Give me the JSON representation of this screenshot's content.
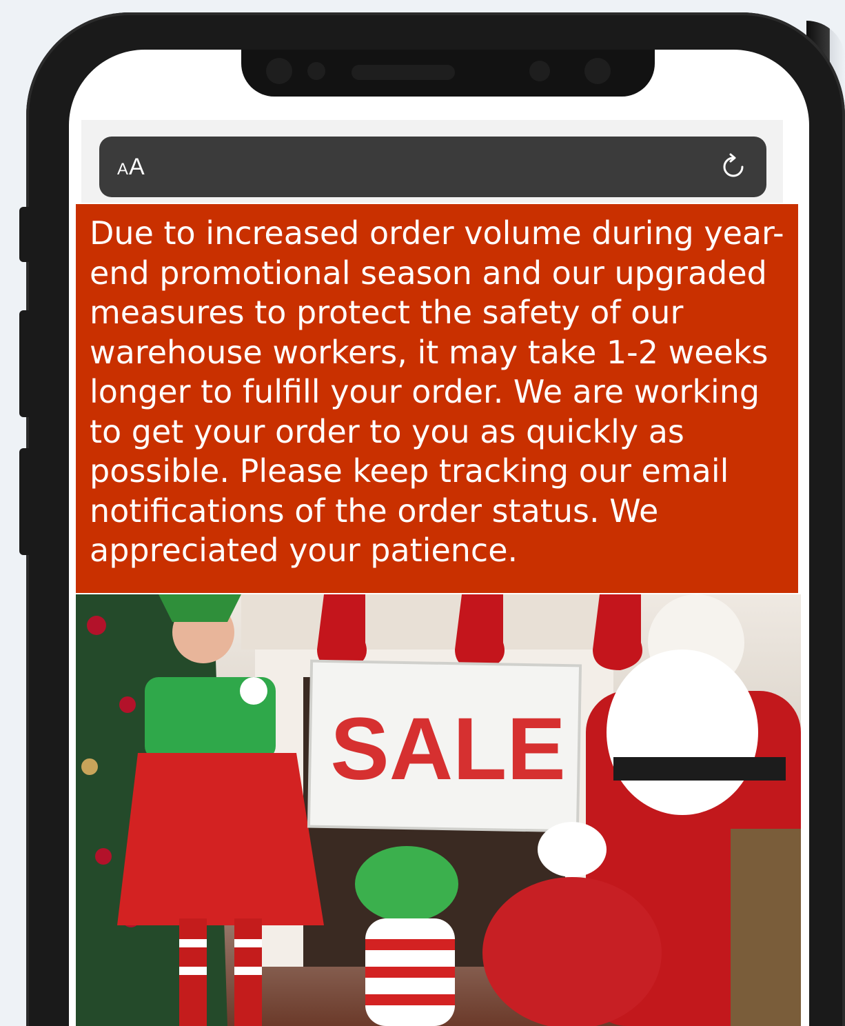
{
  "browser": {
    "text_size_button": {
      "large": "A",
      "small": "A"
    },
    "reload_icon": "reload-icon"
  },
  "notice": {
    "text": "Due to increased order volume during year-end promotional season and our upgraded measures to protect the safety of our warehouse workers, it may take 1-2 weeks longer to fulfill your order. We are working to get your order to you as quickly as possible. Please keep tracking our email notifications of the order status. We appreciated your patience.",
    "background": "#c93000"
  },
  "photo": {
    "sign_text": "SALE"
  }
}
